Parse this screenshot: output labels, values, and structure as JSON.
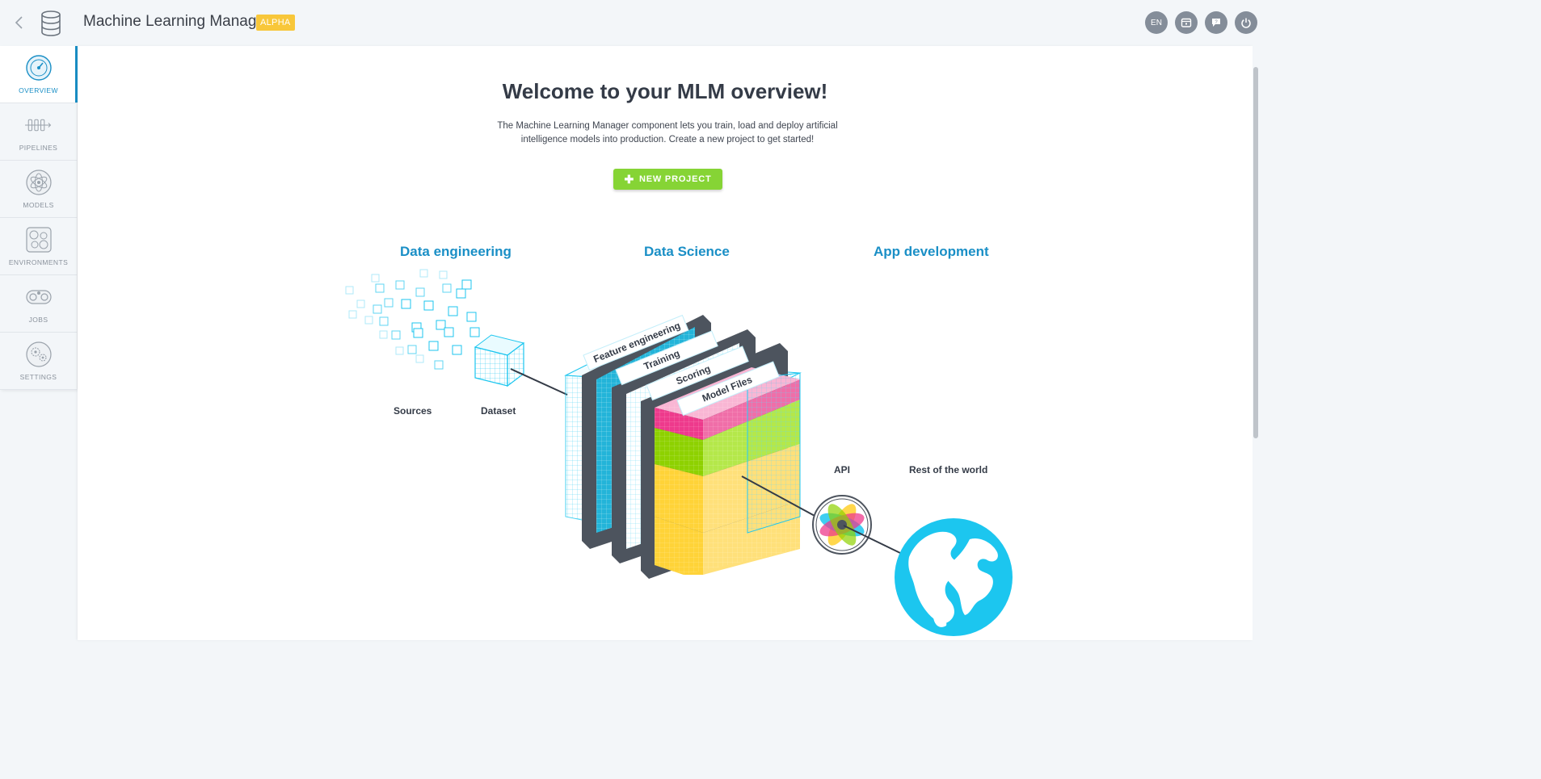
{
  "topbar": {
    "title": "Machine Learning Manager",
    "badge": "ALPHA",
    "icons": [
      "back-chevron-icon",
      "database-icon"
    ],
    "buttons": [
      {
        "name": "language-button",
        "label": "EN"
      },
      {
        "name": "calendar-button",
        "icon": "calendar-icon"
      },
      {
        "name": "help-button",
        "icon": "help-chat-icon"
      },
      {
        "name": "power-button",
        "icon": "power-icon"
      }
    ]
  },
  "sidebar": {
    "items": [
      {
        "label": "OVERVIEW",
        "icon": "speedometer-icon",
        "active": true
      },
      {
        "label": "PIPELINES",
        "icon": "pipeline-icon",
        "active": false
      },
      {
        "label": "MODELS",
        "icon": "atom-icon",
        "active": false
      },
      {
        "label": "ENVIRONMENTS",
        "icon": "cells-icon",
        "active": false
      },
      {
        "label": "JOBS",
        "icon": "gears-icon",
        "active": false
      },
      {
        "label": "SETTINGS",
        "icon": "cog-icon",
        "active": false
      }
    ]
  },
  "main": {
    "title": "Welcome to your MLM overview!",
    "description": "The Machine Learning Manager component lets you train, load and deploy artificial intelligence models into production. Create a new project to get started!",
    "new_project_label": "NEW PROJECT",
    "columns": [
      "Data engineering",
      "Data Science",
      "App development"
    ],
    "illustration": {
      "labels": {
        "sources": "Sources",
        "dataset": "Dataset",
        "api": "API",
        "world": "Rest of the world"
      },
      "layers": [
        "Feature engineering",
        "Training",
        "Scoring",
        "Model Files"
      ]
    }
  },
  "colors": {
    "accent": "#1a8fc6",
    "primary_button": "#86d435",
    "badge": "#f8c73a",
    "cyan": "#1cc6ef",
    "magenta": "#ee3a8c",
    "lime": "#8ed100",
    "yellow": "#ffd338",
    "dark_panel": "#4d545e"
  }
}
